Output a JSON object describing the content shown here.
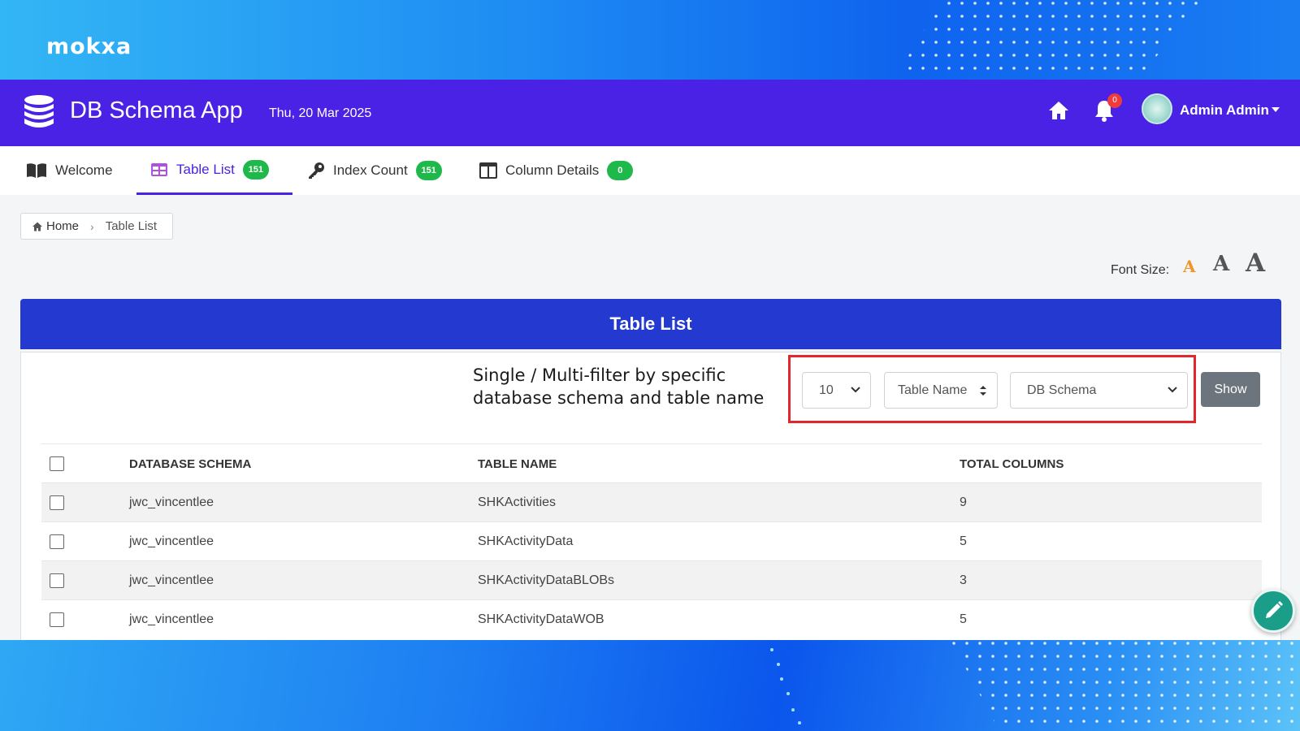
{
  "brand": {
    "logo_text": "mokxa"
  },
  "app": {
    "title": "DB Schema App",
    "date": "Thu, 20 Mar 2025",
    "notification_count": "0",
    "user_name": "Admin Admin"
  },
  "tabs": [
    {
      "label": "Welcome",
      "icon": "book-icon",
      "badge": ""
    },
    {
      "label": "Table List",
      "icon": "table-icon",
      "badge": "151",
      "active": true
    },
    {
      "label": "Index Count",
      "icon": "key-icon",
      "badge": "151"
    },
    {
      "label": "Column Details",
      "icon": "columns-icon",
      "badge": "0"
    }
  ],
  "breadcrumb": {
    "home": "Home",
    "current": "Table List"
  },
  "font_size": {
    "label": "Font Size:",
    "small": "A",
    "medium": "A",
    "large": "A",
    "active_color": "#f0952a"
  },
  "panel": {
    "title": "Table List",
    "annotation_line1": "Single / Multi-filter by specific",
    "annotation_line2": "database schema and table name",
    "page_size": "10",
    "sort_select": "Table Name",
    "schema_select": "DB Schema",
    "show_button": "Show"
  },
  "table": {
    "headers": [
      "DATABASE SCHEMA",
      "TABLE NAME",
      "TOTAL COLUMNS"
    ],
    "rows": [
      [
        "jwc_vincentlee",
        "SHKActivities",
        "9"
      ],
      [
        "jwc_vincentlee",
        "SHKActivityData",
        "5"
      ],
      [
        "jwc_vincentlee",
        "SHKActivityDataBLOBs",
        "3"
      ],
      [
        "jwc_vincentlee",
        "SHKActivityDataWOB",
        "5"
      ]
    ]
  },
  "colors": {
    "topbar": "#4a22e6",
    "panel_header": "#2339cf",
    "badge": "#1fb84a",
    "fab": "#1a9e8a"
  }
}
